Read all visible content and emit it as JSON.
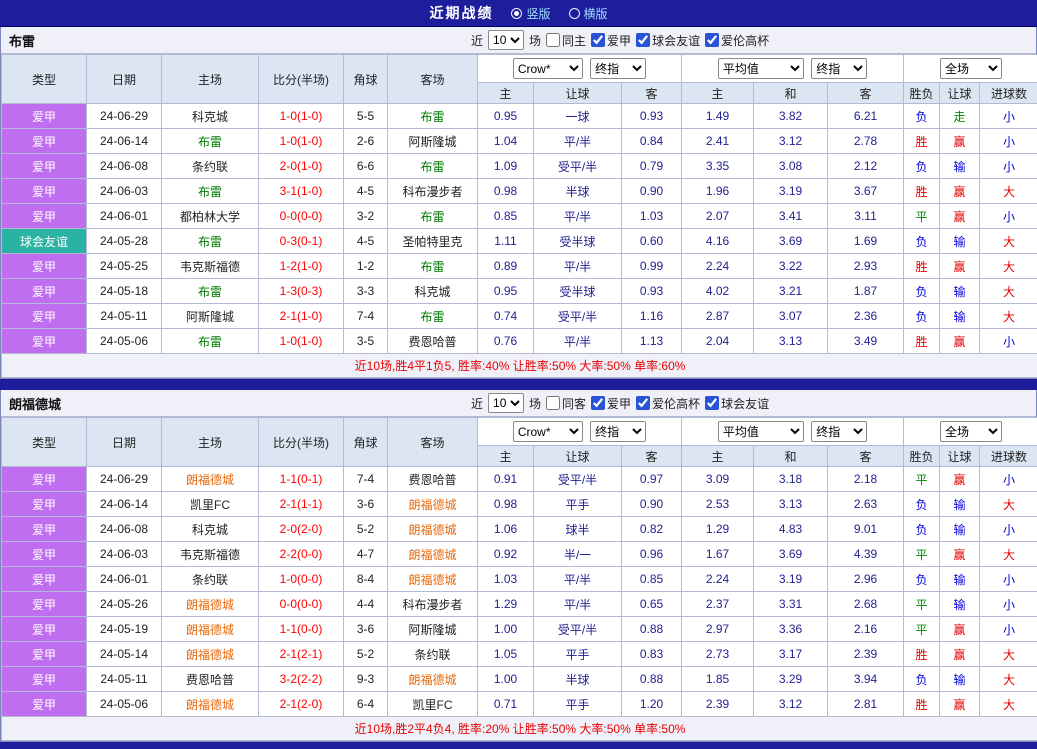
{
  "top_bar": {
    "title": "近期战绩",
    "radios": [
      {
        "label": "竖版",
        "selected": true
      },
      {
        "label": "横版",
        "selected": false
      }
    ]
  },
  "table_header": {
    "type": "类型",
    "date": "日期",
    "home": "主场",
    "score": "比分(半场)",
    "corner": "角球",
    "away": "客场",
    "sub": [
      "主",
      "让球",
      "客",
      "主",
      "和",
      "客",
      "胜负",
      "让球",
      "进球数"
    ]
  },
  "colors": {
    "navy": "#1e1e9c",
    "header_bg": "#dce5f2",
    "type_league": "#c06ef0",
    "type_friendly": "#2cb2a2",
    "score_red": "#ff0000",
    "odds_navy": "#1f1f8f",
    "win_red": "#e60000",
    "loss_blue": "#0000dd",
    "draw_green": "#008800"
  },
  "sections": [
    {
      "team": "布雷",
      "team_color": "#007b00",
      "recent_prefix": "近",
      "recent_count": "10",
      "recent_suffix": "场",
      "filters": [
        {
          "label": "同主",
          "checked": false
        },
        {
          "label": "爱甲",
          "checked": true
        },
        {
          "label": "球会友谊",
          "checked": true
        },
        {
          "label": "爱伦高杯",
          "checked": true
        }
      ],
      "selects": {
        "bookmaker": "Crow*",
        "bookmaker_mode": "终指",
        "average": "平均值",
        "average_mode": "终指",
        "scope": "全场"
      },
      "rows": [
        {
          "type": "爱甲",
          "date": "24-06-29",
          "home": "科克城",
          "score": "1-0(1-0)",
          "corner": "5-5",
          "away": "布雷",
          "odds_home": "0.95",
          "handicap": "一球",
          "odds_away": "0.93",
          "avg_home": "1.49",
          "avg_draw": "3.82",
          "avg_away": "6.21",
          "result": "负",
          "handicap_result": "走",
          "goals": "小"
        },
        {
          "type": "爱甲",
          "date": "24-06-14",
          "home": "布雷",
          "score": "1-0(1-0)",
          "corner": "2-6",
          "away": "阿斯隆城",
          "odds_home": "1.04",
          "handicap": "平/半",
          "odds_away": "0.84",
          "avg_home": "2.41",
          "avg_draw": "3.12",
          "avg_away": "2.78",
          "result": "胜",
          "handicap_result": "赢",
          "goals": "小"
        },
        {
          "type": "爱甲",
          "date": "24-06-08",
          "home": "条约联",
          "score": "2-0(1-0)",
          "corner": "6-6",
          "away": "布雷",
          "odds_home": "1.09",
          "handicap": "受平/半",
          "odds_away": "0.79",
          "avg_home": "3.35",
          "avg_draw": "3.08",
          "avg_away": "2.12",
          "result": "负",
          "handicap_result": "输",
          "goals": "小"
        },
        {
          "type": "爱甲",
          "date": "24-06-03",
          "home": "布雷",
          "score": "3-1(1-0)",
          "corner": "4-5",
          "away": "科布漫步者",
          "odds_home": "0.98",
          "handicap": "半球",
          "odds_away": "0.90",
          "avg_home": "1.96",
          "avg_draw": "3.19",
          "avg_away": "3.67",
          "result": "胜",
          "handicap_result": "赢",
          "goals": "大"
        },
        {
          "type": "爱甲",
          "date": "24-06-01",
          "home": "都柏林大学",
          "score": "0-0(0-0)",
          "corner": "3-2",
          "away": "布雷",
          "odds_home": "0.85",
          "handicap": "平/半",
          "odds_away": "1.03",
          "avg_home": "2.07",
          "avg_draw": "3.41",
          "avg_away": "3.11",
          "result": "平",
          "handicap_result": "赢",
          "goals": "小"
        },
        {
          "type": "球会友谊",
          "date": "24-05-28",
          "home": "布雷",
          "score": "0-3(0-1)",
          "corner": "4-5",
          "away": "圣帕特里克",
          "odds_home": "1.11",
          "handicap": "受半球",
          "odds_away": "0.60",
          "avg_home": "4.16",
          "avg_draw": "3.69",
          "avg_away": "1.69",
          "result": "负",
          "handicap_result": "输",
          "goals": "大"
        },
        {
          "type": "爱甲",
          "date": "24-05-25",
          "home": "韦克斯福德",
          "score": "1-2(1-0)",
          "corner": "1-2",
          "away": "布雷",
          "odds_home": "0.89",
          "handicap": "平/半",
          "odds_away": "0.99",
          "avg_home": "2.24",
          "avg_draw": "3.22",
          "avg_away": "2.93",
          "result": "胜",
          "handicap_result": "赢",
          "goals": "大"
        },
        {
          "type": "爱甲",
          "date": "24-05-18",
          "home": "布雷",
          "score": "1-3(0-3)",
          "corner": "3-3",
          "away": "科克城",
          "odds_home": "0.95",
          "handicap": "受半球",
          "odds_away": "0.93",
          "avg_home": "4.02",
          "avg_draw": "3.21",
          "avg_away": "1.87",
          "result": "负",
          "handicap_result": "输",
          "goals": "大"
        },
        {
          "type": "爱甲",
          "date": "24-05-11",
          "home": "阿斯隆城",
          "score": "2-1(1-0)",
          "corner": "7-4",
          "away": "布雷",
          "odds_home": "0.74",
          "handicap": "受平/半",
          "odds_away": "1.16",
          "avg_home": "2.87",
          "avg_draw": "3.07",
          "avg_away": "2.36",
          "result": "负",
          "handicap_result": "输",
          "goals": "大"
        },
        {
          "type": "爱甲",
          "date": "24-05-06",
          "home": "布雷",
          "score": "1-0(1-0)",
          "corner": "3-5",
          "away": "费恩哈普",
          "odds_home": "0.76",
          "handicap": "平/半",
          "odds_away": "1.13",
          "avg_home": "2.04",
          "avg_draw": "3.13",
          "avg_away": "3.49",
          "result": "胜",
          "handicap_result": "赢",
          "goals": "小"
        }
      ],
      "summary": "近10场,胜4平1负5, 胜率:40% 让胜率:50% 大率:50% 单率:60%"
    },
    {
      "team": "朗福德城",
      "team_color": "#e8680a",
      "recent_prefix": "近",
      "recent_count": "10",
      "recent_suffix": "场",
      "filters": [
        {
          "label": "同客",
          "checked": false
        },
        {
          "label": "爱甲",
          "checked": true
        },
        {
          "label": "爱伦高杯",
          "checked": true
        },
        {
          "label": "球会友谊",
          "checked": true
        }
      ],
      "selects": {
        "bookmaker": "Crow*",
        "bookmaker_mode": "终指",
        "average": "平均值",
        "average_mode": "终指",
        "scope": "全场"
      },
      "rows": [
        {
          "type": "爱甲",
          "date": "24-06-29",
          "home": "朗福德城",
          "score": "1-1(0-1)",
          "corner": "7-4",
          "away": "费恩哈普",
          "odds_home": "0.91",
          "handicap": "受平/半",
          "odds_away": "0.97",
          "avg_home": "3.09",
          "avg_draw": "3.18",
          "avg_away": "2.18",
          "result": "平",
          "handicap_result": "赢",
          "goals": "小"
        },
        {
          "type": "爱甲",
          "date": "24-06-14",
          "home": "凯里FC",
          "score": "2-1(1-1)",
          "corner": "3-6",
          "away": "朗福德城",
          "odds_home": "0.98",
          "handicap": "平手",
          "odds_away": "0.90",
          "avg_home": "2.53",
          "avg_draw": "3.13",
          "avg_away": "2.63",
          "result": "负",
          "handicap_result": "输",
          "goals": "大"
        },
        {
          "type": "爱甲",
          "date": "24-06-08",
          "home": "科克城",
          "score": "2-0(2-0)",
          "corner": "5-2",
          "away": "朗福德城",
          "odds_home": "1.06",
          "handicap": "球半",
          "odds_away": "0.82",
          "avg_home": "1.29",
          "avg_draw": "4.83",
          "avg_away": "9.01",
          "result": "负",
          "handicap_result": "输",
          "goals": "小"
        },
        {
          "type": "爱甲",
          "date": "24-06-03",
          "home": "韦克斯福德",
          "score": "2-2(0-0)",
          "corner": "4-7",
          "away": "朗福德城",
          "odds_home": "0.92",
          "handicap": "半/一",
          "odds_away": "0.96",
          "avg_home": "1.67",
          "avg_draw": "3.69",
          "avg_away": "4.39",
          "result": "平",
          "handicap_result": "赢",
          "goals": "大"
        },
        {
          "type": "爱甲",
          "date": "24-06-01",
          "home": "条约联",
          "score": "1-0(0-0)",
          "corner": "8-4",
          "away": "朗福德城",
          "odds_home": "1.03",
          "handicap": "平/半",
          "odds_away": "0.85",
          "avg_home": "2.24",
          "avg_draw": "3.19",
          "avg_away": "2.96",
          "result": "负",
          "handicap_result": "输",
          "goals": "小"
        },
        {
          "type": "爱甲",
          "date": "24-05-26",
          "home": "朗福德城",
          "score": "0-0(0-0)",
          "corner": "4-4",
          "away": "科布漫步者",
          "odds_home": "1.29",
          "handicap": "平/半",
          "odds_away": "0.65",
          "avg_home": "2.37",
          "avg_draw": "3.31",
          "avg_away": "2.68",
          "result": "平",
          "handicap_result": "输",
          "goals": "小"
        },
        {
          "type": "爱甲",
          "date": "24-05-19",
          "home": "朗福德城",
          "score": "1-1(0-0)",
          "corner": "3-6",
          "away": "阿斯隆城",
          "odds_home": "1.00",
          "handicap": "受平/半",
          "odds_away": "0.88",
          "avg_home": "2.97",
          "avg_draw": "3.36",
          "avg_away": "2.16",
          "result": "平",
          "handicap_result": "赢",
          "goals": "小"
        },
        {
          "type": "爱甲",
          "date": "24-05-14",
          "home": "朗福德城",
          "score": "2-1(2-1)",
          "corner": "5-2",
          "away": "条约联",
          "odds_home": "1.05",
          "handicap": "平手",
          "odds_away": "0.83",
          "avg_home": "2.73",
          "avg_draw": "3.17",
          "avg_away": "2.39",
          "result": "胜",
          "handicap_result": "赢",
          "goals": "大"
        },
        {
          "type": "爱甲",
          "date": "24-05-11",
          "home": "费恩哈普",
          "score": "3-2(2-2)",
          "corner": "9-3",
          "away": "朗福德城",
          "odds_home": "1.00",
          "handicap": "半球",
          "odds_away": "0.88",
          "avg_home": "1.85",
          "avg_draw": "3.29",
          "avg_away": "3.94",
          "result": "负",
          "handicap_result": "输",
          "goals": "大"
        },
        {
          "type": "爱甲",
          "date": "24-05-06",
          "home": "朗福德城",
          "score": "2-1(2-0)",
          "corner": "6-4",
          "away": "凯里FC",
          "odds_home": "0.71",
          "handicap": "平手",
          "odds_away": "1.20",
          "avg_home": "2.39",
          "avg_draw": "3.12",
          "avg_away": "2.81",
          "result": "胜",
          "handicap_result": "赢",
          "goals": "大"
        }
      ],
      "summary": "近10场,胜2平4负4, 胜率:20% 让胜率:50% 大率:50% 单率:50%"
    }
  ]
}
